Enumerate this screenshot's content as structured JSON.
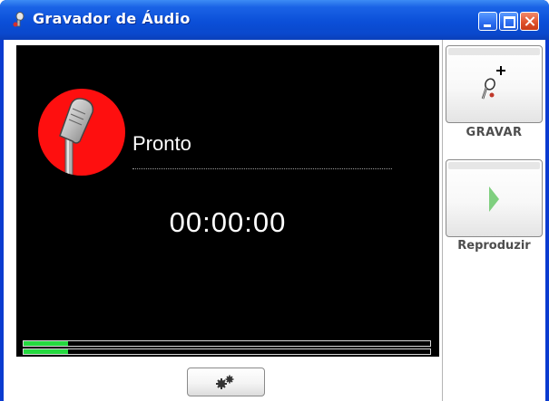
{
  "window": {
    "title": "Gravador de Áudio",
    "controls": [
      "minimize",
      "maximize",
      "close"
    ]
  },
  "display": {
    "status": "Pronto",
    "timer": "00:00:00",
    "level_meters": [
      {
        "channel": "left",
        "level": 0.11
      },
      {
        "channel": "right",
        "level": 0.11
      }
    ]
  },
  "actions": {
    "record_label": "GRAVAR",
    "play_label": "Reproduzir"
  },
  "icons": {
    "title": "microphone-icon",
    "status": "microphone-icon",
    "record": "microphone-plus-icon",
    "play": "play-icon",
    "settings": "gears-icon"
  },
  "colors": {
    "title_bar": "#0b4fd8",
    "display_bg": "#000000",
    "status_circle": "#fe0f0f",
    "level_fill": "#25d93f",
    "play_arrow": "#7fcf7f",
    "record_dot": "#c0392b"
  }
}
